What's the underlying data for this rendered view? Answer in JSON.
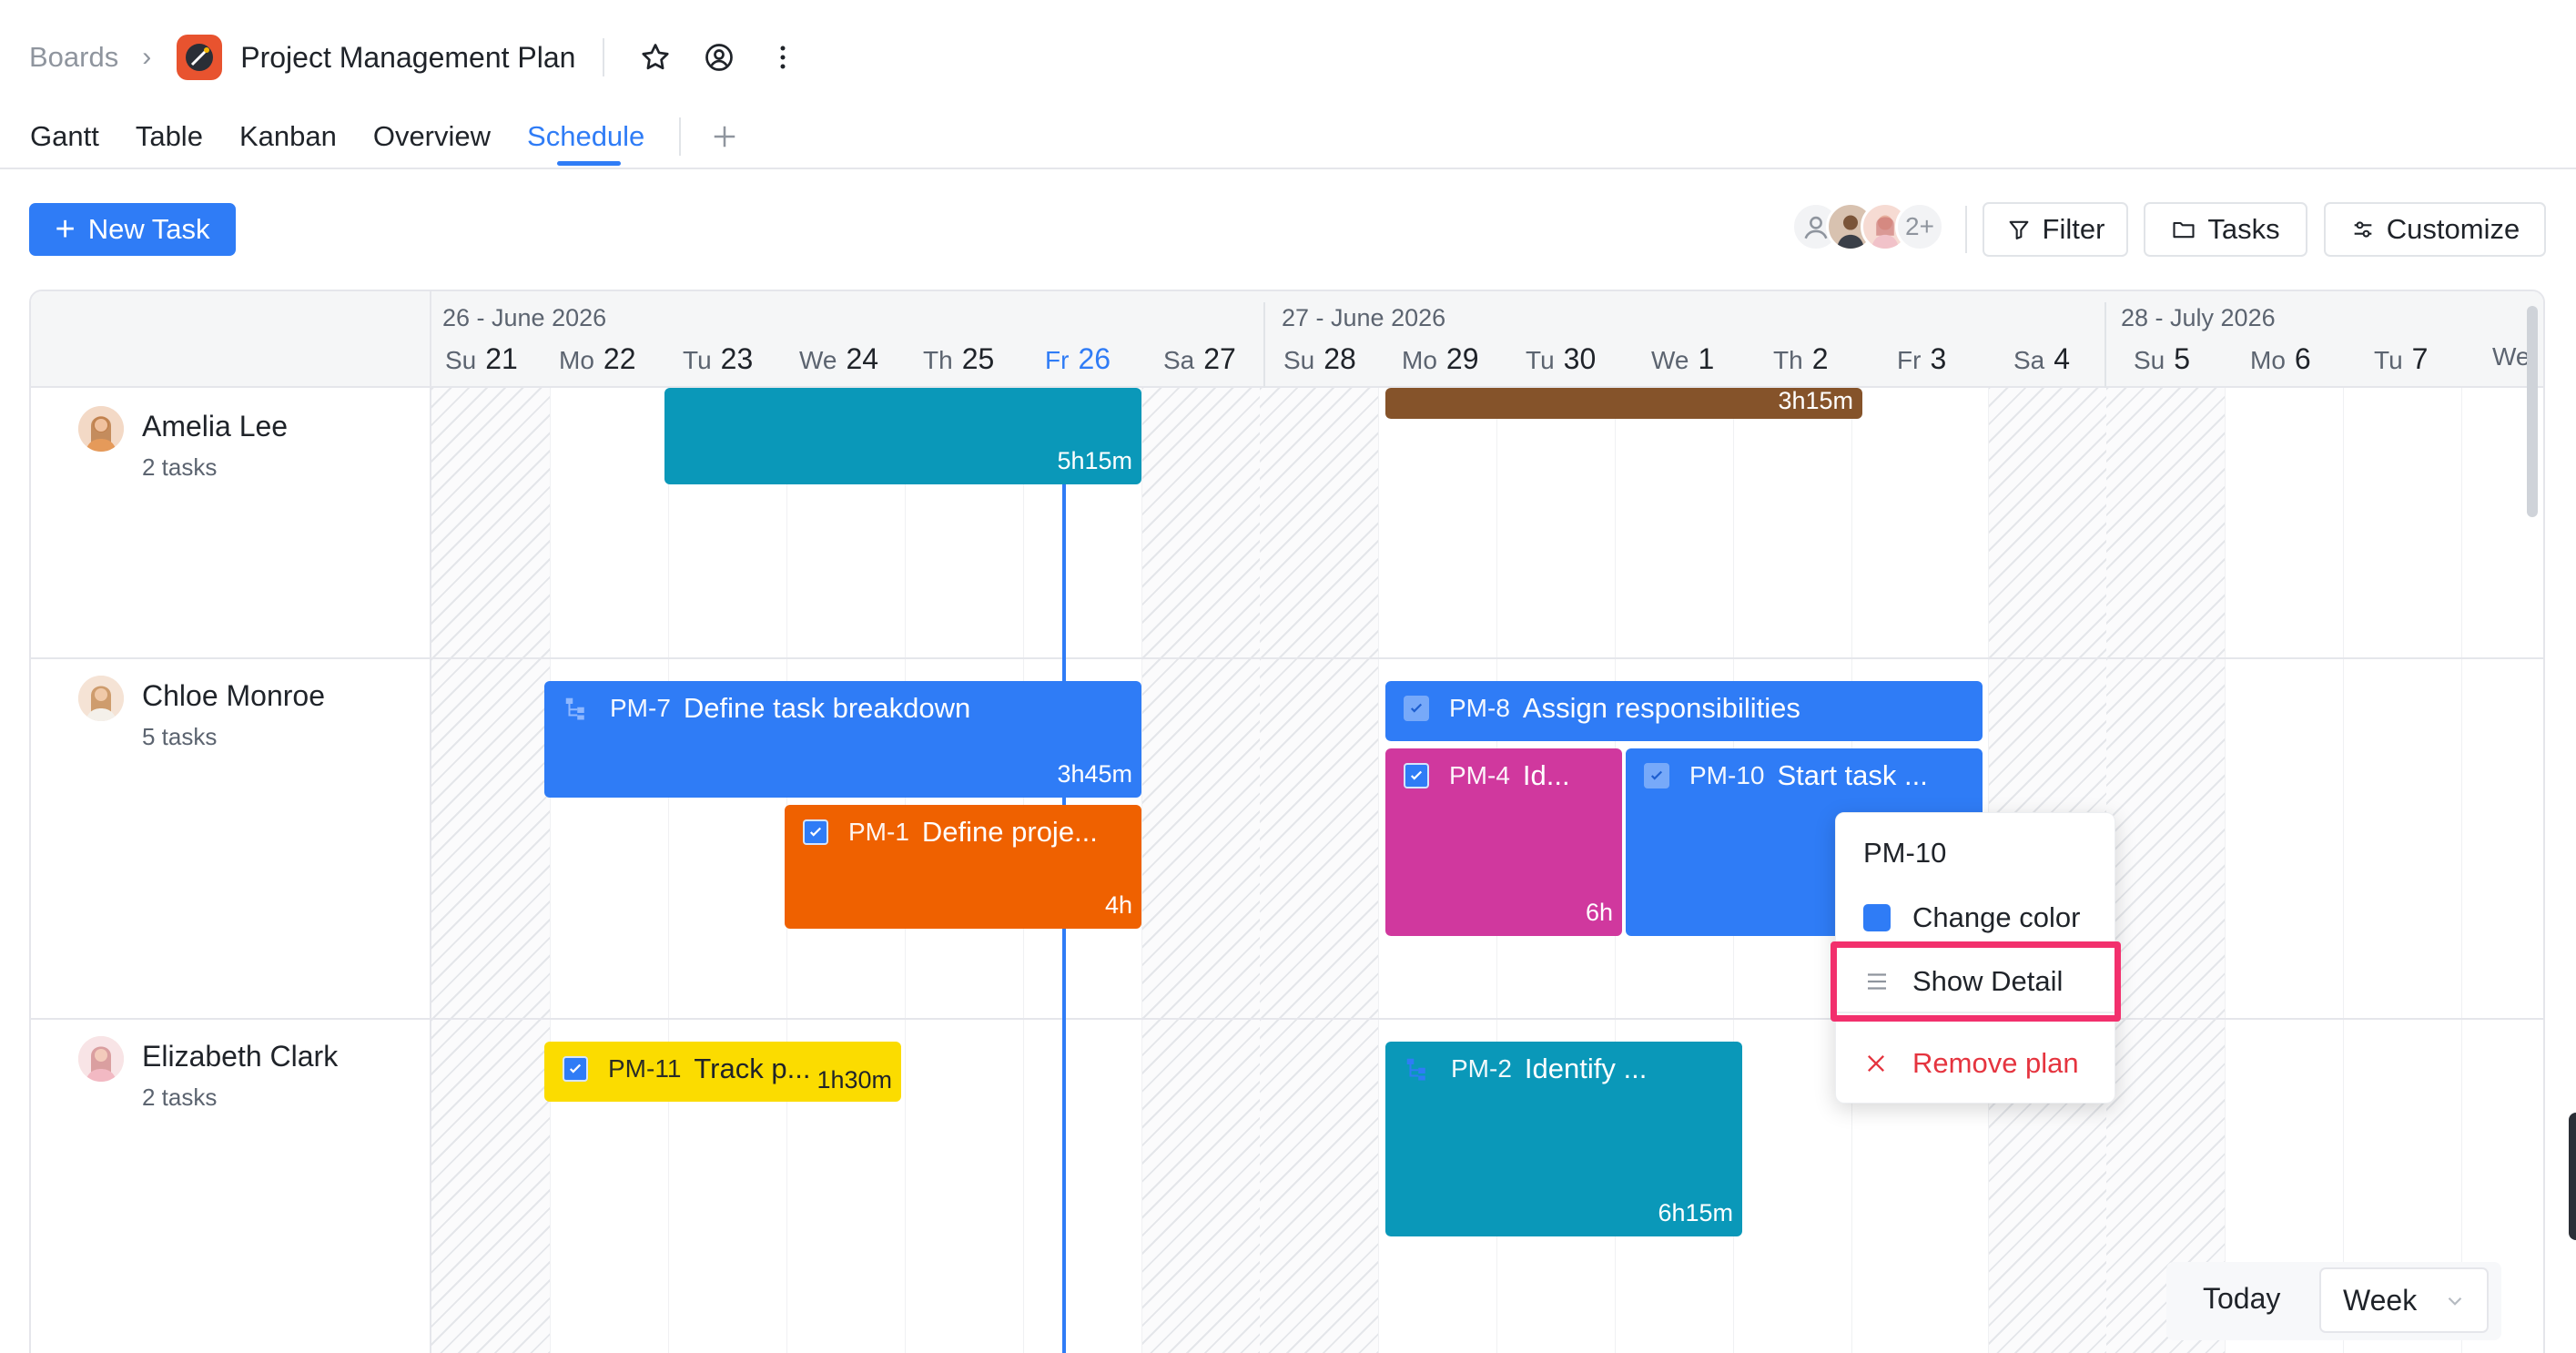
{
  "breadcrumb": {
    "root": "Boards",
    "project": "Project Management Plan"
  },
  "tabs": [
    "Gantt",
    "Table",
    "Kanban",
    "Overview",
    "Schedule"
  ],
  "active_tab": "Schedule",
  "toolbar": {
    "new_task": "New Task",
    "more_members": "2+",
    "filter": "Filter",
    "tasks": "Tasks",
    "customize": "Customize"
  },
  "timeline": {
    "months": [
      "26 - June 2026",
      "27 - June 2026",
      "28 - July 2026"
    ],
    "days": [
      {
        "dow": "Su",
        "num": "21"
      },
      {
        "dow": "Mo",
        "num": "22"
      },
      {
        "dow": "Tu",
        "num": "23"
      },
      {
        "dow": "We",
        "num": "24"
      },
      {
        "dow": "Th",
        "num": "25"
      },
      {
        "dow": "Fr",
        "num": "26"
      },
      {
        "dow": "Sa",
        "num": "27"
      },
      {
        "dow": "Su",
        "num": "28"
      },
      {
        "dow": "Mo",
        "num": "29"
      },
      {
        "dow": "Tu",
        "num": "30"
      },
      {
        "dow": "We",
        "num": "1"
      },
      {
        "dow": "Th",
        "num": "2"
      },
      {
        "dow": "Fr",
        "num": "3"
      },
      {
        "dow": "Sa",
        "num": "4"
      },
      {
        "dow": "Su",
        "num": "5"
      },
      {
        "dow": "Mo",
        "num": "6"
      },
      {
        "dow": "Tu",
        "num": "7"
      },
      {
        "dow": "We",
        "num": ""
      }
    ],
    "today": "Fr 26"
  },
  "people": [
    {
      "name": "Amelia Lee",
      "count": "2 tasks"
    },
    {
      "name": "Chloe Monroe",
      "count": "5 tasks"
    },
    {
      "name": "Elizabeth Clark",
      "count": "2 tasks"
    }
  ],
  "tasks": {
    "amelia_1": {
      "duration": "5h15m",
      "color": "#0a98b9"
    },
    "amelia_2": {
      "duration": "3h15m",
      "color": "#85532a"
    },
    "pm7": {
      "code": "PM-7",
      "title": "Define task breakdown",
      "duration": "3h45m",
      "color": "#2f7cf6"
    },
    "pm1": {
      "code": "PM-1",
      "title": "Define proje...",
      "duration": "4h",
      "color": "#ef6100"
    },
    "pm8": {
      "code": "PM-8",
      "title": "Assign responsibilities",
      "color": "#2f7cf6"
    },
    "pm4": {
      "code": "PM-4",
      "title": "Id...",
      "duration": "6h",
      "color": "#d0389e"
    },
    "pm10": {
      "code": "PM-10",
      "title": "Start task ...",
      "color": "#2f7cf6"
    },
    "pm11": {
      "code": "PM-11",
      "title": "Track p...",
      "duration": "1h30m",
      "color": "#fbdc00"
    },
    "pm2": {
      "code": "PM-2",
      "title": "Identify ...",
      "duration": "6h15m",
      "color": "#0a98b9"
    }
  },
  "context_menu": {
    "title": "PM-10",
    "change_color": "Change color",
    "show_detail": "Show Detail",
    "remove_plan": "Remove plan"
  },
  "bottom": {
    "today": "Today",
    "view": "Week"
  }
}
